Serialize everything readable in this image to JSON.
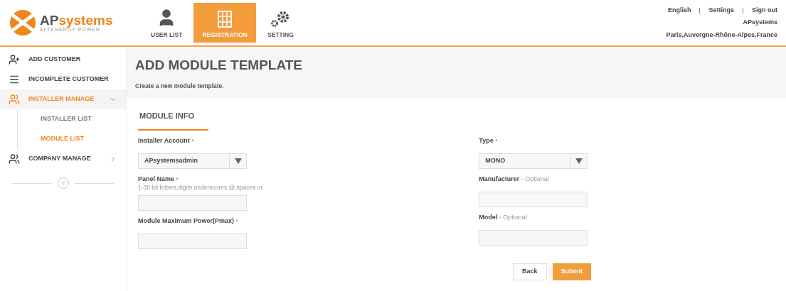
{
  "logo": {
    "name_a": "AP",
    "name_b": "systems",
    "tagline": "ALTENERGY POWER"
  },
  "nav": [
    {
      "label": "USER LIST",
      "kind": "user",
      "selected": false
    },
    {
      "label": "REGISTRATION",
      "kind": "panel",
      "selected": true
    },
    {
      "label": "SETTING",
      "kind": "gears",
      "selected": false
    }
  ],
  "top_links": [
    "English",
    "Settings",
    "Sign out"
  ],
  "user": {
    "name": "APsystems",
    "location": "Paris,Auvergne-Rhône-Alpes,France"
  },
  "sidebar": {
    "items": [
      {
        "label": "ADD CUSTOMER",
        "kind": "add-user",
        "selected": false
      },
      {
        "label": "INCOMPLETE CUSTOMER",
        "kind": "list",
        "selected": false
      },
      {
        "label": "INSTALLER MANAGE",
        "kind": "users",
        "selected": true,
        "expanded": true,
        "children": [
          {
            "label": "INSTALLER LIST",
            "selected": false
          },
          {
            "label": "MODULE LIST",
            "selected": true
          }
        ]
      },
      {
        "label": "COMPANY MANAGE",
        "kind": "users",
        "selected": false,
        "expanded": false
      }
    ]
  },
  "page": {
    "title": "ADD MODULE TEMPLATE",
    "subtitle": "Create a new module template."
  },
  "section": "MODULE INFO",
  "columns": [
    [
      {
        "label": "Installer Account",
        "marker": "•",
        "kind": "select",
        "value": "APsystemsadmin"
      },
      {
        "label": "Panel Name",
        "marker": "•",
        "kind": "text",
        "hint": "1-30 bit letters,digits,underscores,@,spaces or."
      },
      {
        "label": "Module Maximum Power(Pmax)",
        "marker": "•",
        "kind": "text"
      }
    ],
    [
      {
        "label": "Type",
        "marker": "•",
        "kind": "select",
        "value": "MONO"
      },
      {
        "label": "Manufacturer",
        "marker": "- Optional",
        "kind": "text"
      },
      {
        "label": "Model",
        "marker": "- Optional",
        "kind": "text"
      }
    ]
  ],
  "buttons": [
    {
      "label": "Back",
      "kind": "secondary"
    },
    {
      "label": "Submit",
      "kind": "primary"
    }
  ]
}
